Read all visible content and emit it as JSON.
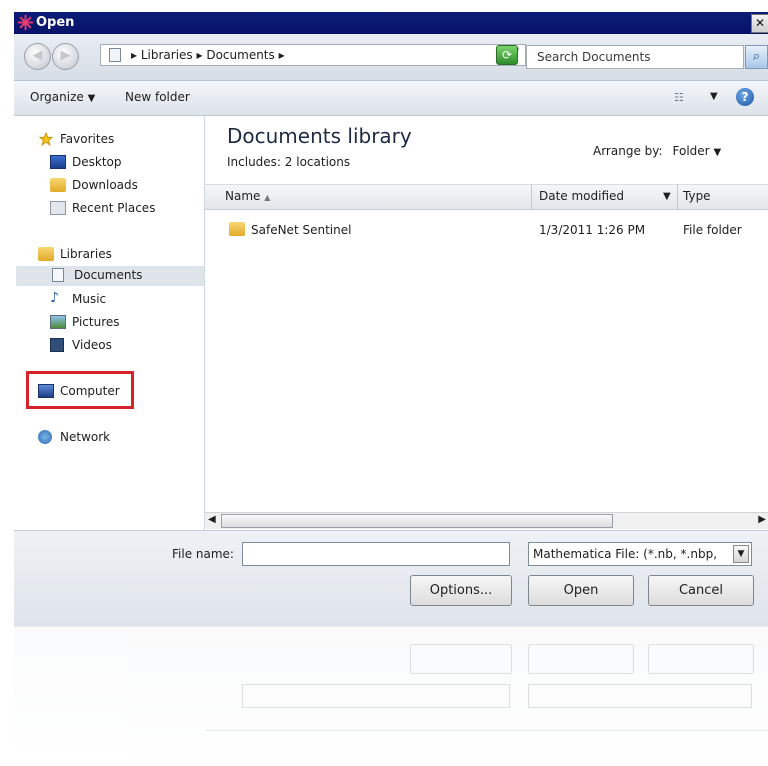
{
  "window": {
    "title": "Open",
    "close_glyph": "✕",
    "colors": {
      "titlebar": "#0c1d78",
      "highlight_border": "#d6232b",
      "selection": "#dfe4ea"
    }
  },
  "address_bar": {
    "breadcrumb": [
      "Libraries",
      "Documents"
    ],
    "search_placeholder": "Search Documents",
    "icons": [
      "back-icon",
      "forward-icon",
      "documents-folder-icon",
      "refresh-icon",
      "search-icon"
    ]
  },
  "toolbar": {
    "organize_label": "Organize",
    "new_folder_label": "New folder"
  },
  "sidebar": {
    "favorites": {
      "label": "Favorites",
      "items": [
        "Desktop",
        "Downloads",
        "Recent Places"
      ]
    },
    "libraries": {
      "label": "Libraries",
      "items": [
        "Documents",
        "Music",
        "Pictures",
        "Videos"
      ],
      "selected": "Documents"
    },
    "computer": "Computer",
    "network": "Network"
  },
  "content": {
    "title": "Documents library",
    "includes": "Includes:  2 locations",
    "arrange_label": "Arrange by:",
    "arrange_value": "Folder",
    "columns": {
      "name": "Name",
      "date_modified": "Date modified",
      "type": "Type"
    },
    "rows": [
      {
        "name": "SafeNet Sentinel",
        "date_modified": "1/3/2011 1:26 PM",
        "type": "File folder"
      }
    ]
  },
  "bottom": {
    "file_name_label": "File name:",
    "file_name_value": "",
    "file_type": "Mathematica File: (*.nb, *.nbp,",
    "options_label": "Options...",
    "open_label": "Open",
    "cancel_label": "Cancel"
  }
}
